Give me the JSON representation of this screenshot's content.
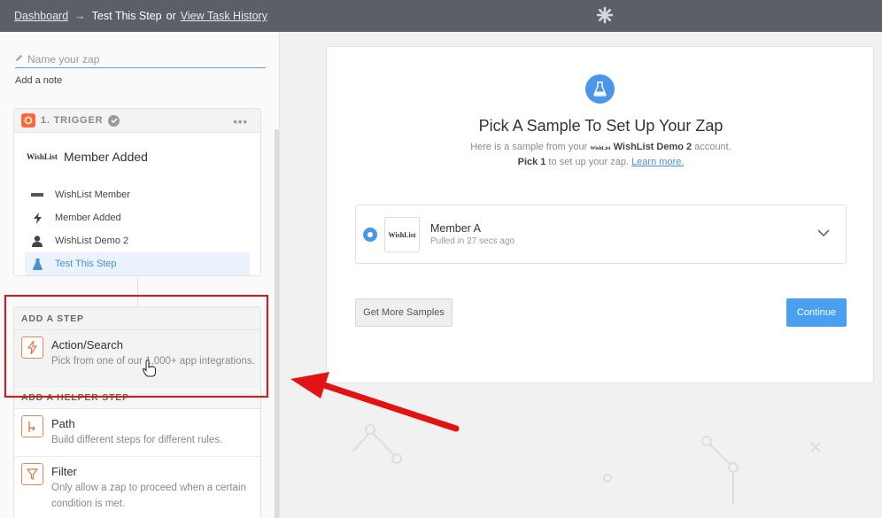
{
  "topbar": {
    "dashboard": "Dashboard",
    "arrow": "→",
    "current": "Test This Step",
    "or": "or",
    "history": "View Task History"
  },
  "sidebar": {
    "zap_placeholder": "Name your zap",
    "add_note": "Add a note",
    "trigger": {
      "label": "1. TRIGGER",
      "menu": "•••",
      "app_logo": "WishList",
      "event_title": "Member Added",
      "steps": [
        {
          "label": "WishList Member",
          "icon": "wishlist-logo"
        },
        {
          "label": "Member Added",
          "icon": "bolt-icon"
        },
        {
          "label": "WishList Demo 2",
          "icon": "person-icon"
        },
        {
          "label": "Test This Step",
          "icon": "flask-icon"
        }
      ]
    },
    "add_step": {
      "header": "ADD A STEP",
      "action": {
        "title": "Action/Search",
        "desc": "Pick from one of our 1,000+ app integrations."
      }
    },
    "helper": {
      "header": "ADD A HELPER STEP",
      "path": {
        "title": "Path",
        "desc": "Build different steps for different rules."
      },
      "filter": {
        "title": "Filter",
        "desc": "Only allow a zap to proceed when a certain condition is met."
      }
    }
  },
  "main": {
    "title": "Pick A Sample To Set Up Your Zap",
    "sub1_a": "Here is a sample from your",
    "sub1_logo": "WishList",
    "sub1_app": "WishList Demo 2",
    "sub1_b": "account.",
    "sub2_pick": "Pick 1",
    "sub2_text": "to set up your zap.",
    "learn_more": "Learn more.",
    "sample": {
      "logo": "WishList",
      "name": "Member A",
      "time": "Pulled in 27 secs ago"
    },
    "btn_more": "Get More Samples",
    "btn_continue": "Continue"
  },
  "colors": {
    "accent": "#4a96e8",
    "zapier_orange": "#ff6a3d",
    "highlight": "#e21313"
  }
}
